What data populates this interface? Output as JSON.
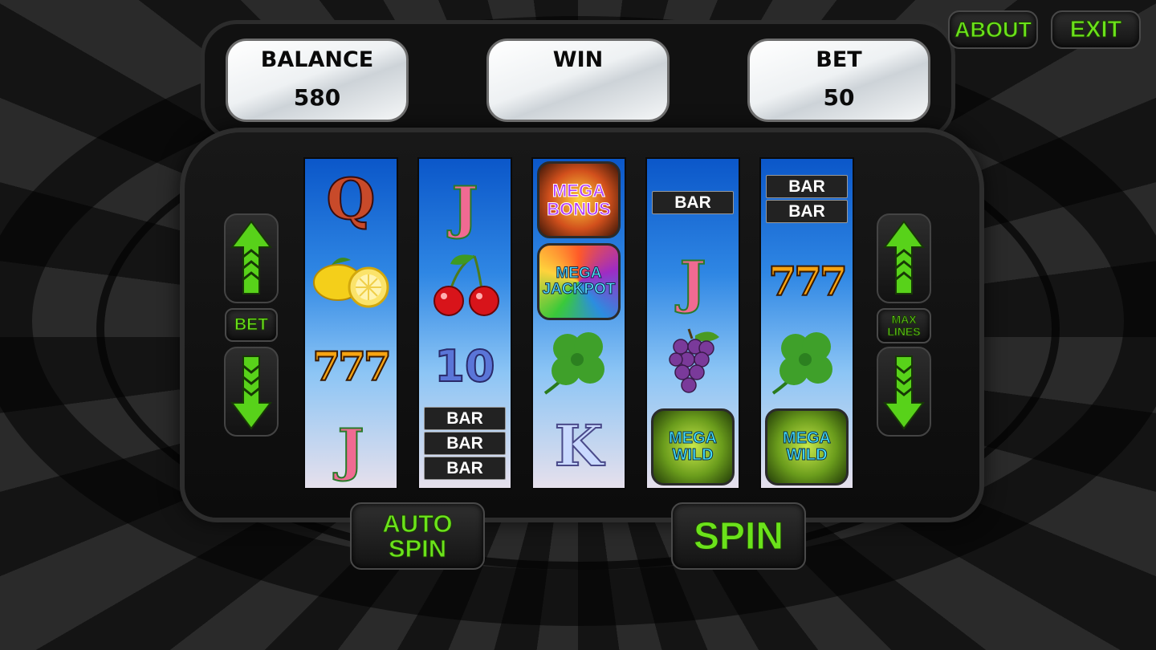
{
  "header": {
    "about_label": "ABOUT",
    "exit_label": "EXIT"
  },
  "panels": {
    "balance": {
      "label": "BALANCE",
      "value": "580"
    },
    "win": {
      "label": "WIN",
      "value": ""
    },
    "bet": {
      "label": "BET",
      "value": "50"
    }
  },
  "left_controls": {
    "bet_label": "BET"
  },
  "right_controls": {
    "max_lines_label_1": "MAX",
    "max_lines_label_2": "LINES"
  },
  "reels": [
    {
      "symbols": [
        "Q",
        "lemon",
        "777",
        "J"
      ]
    },
    {
      "symbols": [
        "J",
        "cherries",
        "10",
        "BAR BAR BAR"
      ]
    },
    {
      "symbols": [
        "MEGA BONUS",
        "MEGA JACKPOT",
        "clover",
        "K"
      ]
    },
    {
      "symbols": [
        "BAR",
        "J",
        "grapes",
        "MEGA WILD"
      ]
    },
    {
      "symbols": [
        "BAR BAR",
        "777",
        "clover",
        "MEGA WILD"
      ]
    }
  ],
  "symbol_text": {
    "q": "Q",
    "j": "J",
    "k": "K",
    "ten": "10",
    "sevens": "777",
    "bar": "BAR",
    "mega": "MEGA",
    "bonus": "BONUS",
    "jackpot": "JACKPOT",
    "wild": "WILD"
  },
  "bottom": {
    "auto_spin_1": "AUTO",
    "auto_spin_2": "SPIN",
    "spin_label": "SPIN"
  },
  "colors": {
    "accent_green": "#6be21b",
    "panel_white": "#f4f6f7",
    "reel_blue": "#2f87e4"
  }
}
